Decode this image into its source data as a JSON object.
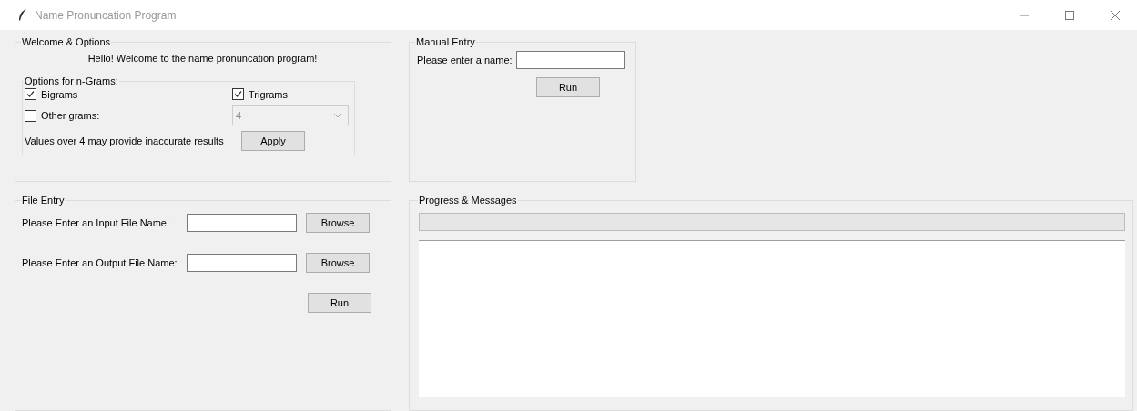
{
  "window": {
    "title": "Name Pronuncation Program"
  },
  "welcome": {
    "title": "Welcome & Options",
    "greeting": "Hello! Welcome to the name pronuncation program!",
    "ngrams": {
      "title": "Options for n-Grams:",
      "options": [
        {
          "label": "Bigrams",
          "checked": true
        },
        {
          "label": "Trigrams",
          "checked": true
        },
        {
          "label": "Other grams:",
          "checked": false
        }
      ],
      "other_value": {
        "value": "4",
        "disabled": true
      },
      "note": "Values over 4 may provide inaccurate results",
      "apply_button": "Apply"
    }
  },
  "manual_entry": {
    "title": "Manual Entry",
    "label": "Please enter a name:",
    "run_button": "Run"
  },
  "file_entry": {
    "title": "File Entry",
    "rows": [
      {
        "label": "Please Enter an Input File Name:",
        "button": "Browse"
      },
      {
        "label": "Please Enter an Output File Name:",
        "button": "Browse"
      }
    ],
    "run_button": "Run"
  },
  "progress": {
    "title": "Progress & Messages",
    "level": 0
  }
}
